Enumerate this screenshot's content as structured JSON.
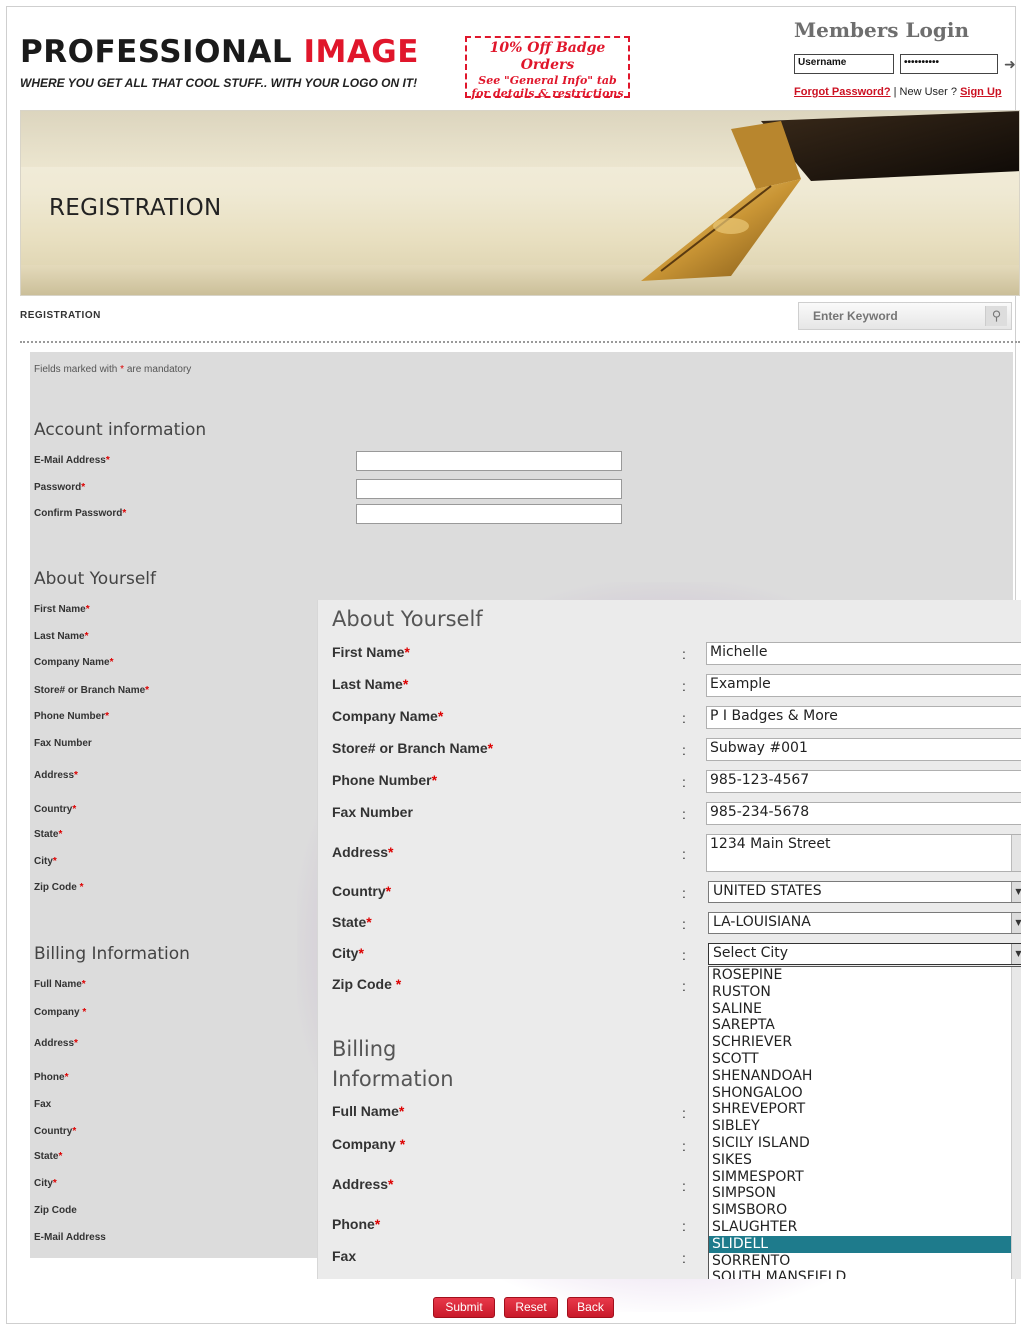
{
  "header": {
    "logo_word1": "PROFESSIONAL ",
    "logo_word2": "IMAGE",
    "tagline": "WHERE YOU GET ALL THAT COOL STUFF.. WITH YOUR LOGO ON IT!",
    "promo_line1": "10% Off Badge Orders",
    "promo_line2": "See \"General Info\" tab",
    "promo_line3": "for details & restrictions"
  },
  "members_login": {
    "title": "Members Login",
    "username_value": "Username",
    "password_value": "••••••••••",
    "forgot_link": "Forgot Password?",
    "separator": " | New User ? ",
    "signup_link": "Sign Up"
  },
  "banner": {
    "title": "REGISTRATION"
  },
  "breadcrumb": "REGISTRATION",
  "search": {
    "placeholder": "Enter Keyword"
  },
  "form_bg": {
    "mandatory_prefix": "Fields marked with ",
    "mandatory_star": "*",
    "mandatory_suffix": " are mandatory",
    "account_title": "Account information",
    "account_labels": [
      "E-Mail Address",
      "Password",
      "Confirm Password"
    ],
    "about_title": "About Yourself",
    "about_labels": [
      "First Name",
      "Last Name",
      "Company Name",
      "Store# or Branch Name",
      "Phone Number",
      "Fax Number",
      "Address",
      "Country",
      "State",
      "City",
      "Zip Code "
    ],
    "billing_title": "Billing Information",
    "billing_labels": [
      "Full Name",
      "Company ",
      "Address",
      "Phone",
      "Fax",
      "Country",
      "State",
      "City",
      "Zip Code",
      "E-Mail Address"
    ]
  },
  "callout": {
    "about_title": "About Yourself",
    "billing_title_1": "Billing",
    "billing_title_2": "Information",
    "colon": ":",
    "labels": {
      "first_name": "First Name",
      "last_name": "Last Name",
      "company_name": "Company Name",
      "store": "Store# or Branch Name",
      "phone": "Phone Number",
      "fax": "Fax Number",
      "address": "Address",
      "country": "Country",
      "state": "State",
      "city": "City",
      "zip": "Zip Code ",
      "b_full_name": "Full Name",
      "b_company": "Company ",
      "b_address": "Address",
      "b_phone": "Phone",
      "b_fax": "Fax"
    },
    "values": {
      "first_name": "Michelle",
      "last_name": "Example",
      "company_name": "P I Badges & More",
      "store": "Subway #001",
      "phone": "985-123-4567",
      "fax": "985-234-5678",
      "address": "1234 Main Street",
      "country": "UNITED STATES",
      "state": "LA-LOUISIANA",
      "city": "Select City"
    },
    "star": "*",
    "city_options": [
      "ROSEPINE",
      "RUSTON",
      "SALINE",
      "SAREPTA",
      "SCHRIEVER",
      "SCOTT",
      "SHENANDOAH",
      "SHONGALOO",
      "SHREVEPORT",
      "SIBLEY",
      "SICILY ISLAND",
      "SIKES",
      "SIMMESPORT",
      "SIMPSON",
      "SIMSBORO",
      "SLAUGHTER",
      "SLIDELL",
      "SORRENTO",
      "SOUTH MANSFIELD"
    ],
    "city_selected": "SLIDELL"
  },
  "buttons": {
    "submit": "Submit",
    "reset": "Reset",
    "back": "Back"
  },
  "colors": {
    "brand_red": "#e0162b",
    "highlight": "#1e7b8c",
    "form_bg": "#dcdcdc"
  }
}
